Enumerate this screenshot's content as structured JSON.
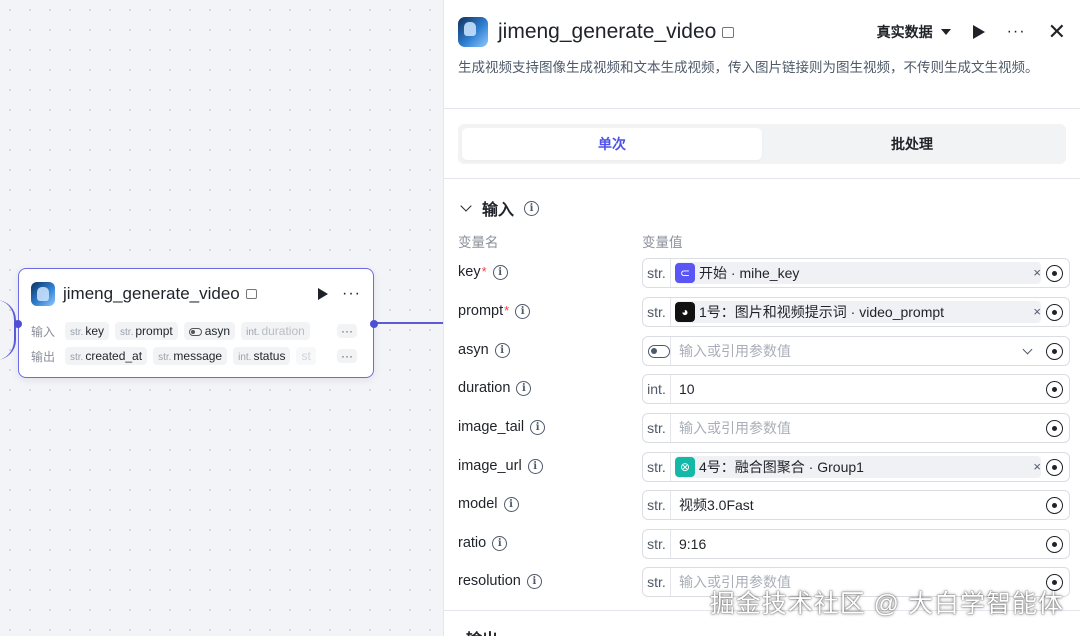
{
  "canvas": {
    "node": {
      "title": "jimeng_generate_video",
      "input_label": "输入",
      "output_label": "输出",
      "inputs": [
        {
          "type": "str.",
          "name": "key"
        },
        {
          "type": "str.",
          "name": "prompt"
        },
        {
          "type": "toggle",
          "name": "asyn"
        },
        {
          "type": "int.",
          "name": "duration"
        }
      ],
      "outputs": [
        {
          "type": "str.",
          "name": "created_at"
        },
        {
          "type": "str.",
          "name": "message"
        },
        {
          "type": "int.",
          "name": "status"
        },
        {
          "type": "",
          "name": "st"
        }
      ],
      "more": "···"
    }
  },
  "panel": {
    "title": "jimeng_generate_video",
    "data_mode": "真实数据",
    "more": "···",
    "close": "✕",
    "description": "生成视频支持图像生成视频和文本生成视频，传入图片链接则为图生视频，不传则生成文生视频。",
    "tabs": [
      {
        "label": "单次",
        "active": true
      },
      {
        "label": "批处理",
        "active": false
      }
    ],
    "input_section": {
      "title": "输入",
      "col_name": "变量名",
      "col_value": "变量值",
      "params": [
        {
          "name": "key",
          "required": true,
          "type": "str.",
          "kind": "ref",
          "ref_icon": "start",
          "ref_text": "开始 · mihe_key"
        },
        {
          "name": "prompt",
          "required": true,
          "type": "str.",
          "kind": "ref",
          "ref_icon": "bot",
          "ref_text": "1号：图片和视频提示词 · video_prompt"
        },
        {
          "name": "asyn",
          "required": false,
          "type": "toggle",
          "kind": "select",
          "value": "输入或引用参数值"
        },
        {
          "name": "duration",
          "required": false,
          "type": "int.",
          "kind": "value",
          "value": "10"
        },
        {
          "name": "image_tail",
          "required": false,
          "type": "str.",
          "kind": "placeholder",
          "value": "输入或引用参数值"
        },
        {
          "name": "image_url",
          "required": false,
          "type": "str.",
          "kind": "ref",
          "ref_icon": "group",
          "ref_text": "4号：融合图聚合 · Group1"
        },
        {
          "name": "model",
          "required": false,
          "type": "str.",
          "kind": "value",
          "value": "视频3.0Fast"
        },
        {
          "name": "ratio",
          "required": false,
          "type": "str.",
          "kind": "value",
          "value": "9:16"
        },
        {
          "name": "resolution",
          "required": false,
          "type": "str.",
          "kind": "placeholder",
          "value": "输入或引用参数值"
        }
      ]
    },
    "output_section": {
      "title": "输出"
    }
  },
  "watermark": "掘金技术社区 @ 大白学智能体",
  "colors": {
    "accent": "#4d53e8",
    "node_border": "#6b6be6",
    "required": "#f53f3f"
  }
}
